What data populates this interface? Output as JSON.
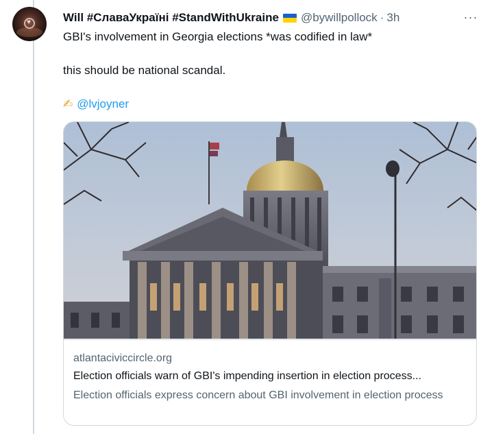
{
  "tweet": {
    "display_name": "Will #СлаваУкраїні #StandWithUkraine",
    "flag_icon": "ukraine-flag-icon",
    "handle": "@bywillpollock",
    "separator": "·",
    "time": "3h",
    "more_icon": "···",
    "text_line1": "GBI's involvement in Georgia elections *was codified in law*",
    "text_line2": "this should be national scandal.",
    "pen_icon": "✍",
    "mention": "@lvjoyner"
  },
  "card": {
    "image_icon": "georgia-capitol-photo",
    "domain": "atlantaciviccircle.org",
    "title": "Election officials warn of GBI's impending insertion in election process...",
    "description": "Election officials express concern about GBI involvement in election process"
  },
  "colors": {
    "text_primary": "#0f1419",
    "text_secondary": "#536471",
    "link": "#1d9bf0",
    "border": "#cfd9de"
  }
}
